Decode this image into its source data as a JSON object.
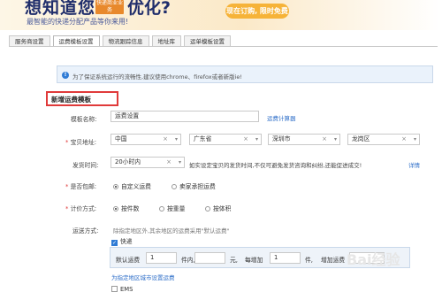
{
  "banner": {
    "headline_1": "想知道您",
    "tag": "快递商业业务",
    "headline_2": "优化?",
    "subtitle": "最智能的快递分配产品等你来用!",
    "cta": "现在订购, 限时免费"
  },
  "tabs": [
    "服务商设置",
    "运费模板设置",
    "物流跟踪信息",
    "地址库",
    "运单模板设置"
  ],
  "info": {
    "icon": "!",
    "text": "为了保证系统运行的流畅性,建议使用chrome、firefox或者新版ie!"
  },
  "section_title": "新增运费模板",
  "form": {
    "template_name_label": "模板名称:",
    "template_name_value": "运费设置",
    "calculator_link": "运费计算器",
    "origin_label": "宝贝地址:",
    "country": "中国",
    "province": "广东省",
    "city": "深圳市",
    "district": "龙岗区",
    "ship_time_label": "发货时间:",
    "ship_time_value": "20小时内",
    "ship_time_hint": "如实设定宝贝的发货时间,不仅可避免发货咨询和纠纷,还能促进成交!",
    "ship_time_link": "详情",
    "free_ship_label": "是否包邮:",
    "free_ship_options": [
      "自定义运费",
      "卖家承担运费"
    ],
    "pricing_label": "计价方式:",
    "pricing_options": [
      "按件数",
      "按重量",
      "按体积"
    ],
    "method_label": "运送方式:",
    "method_hint": "除指定地区外,其余地区的运费采用\"默认运费\"",
    "express_label": "快递",
    "fee": {
      "default_label": "默认运费",
      "first_value": "1",
      "unit_1": "件内,",
      "price_value": "",
      "unit_2": "元,",
      "each_add_label": "每增加",
      "add_value": "1",
      "unit_3": "件,",
      "add_fee_label": "增加运费"
    },
    "specify_link": "为指定地区城市设置运费",
    "ems_label": "EMS"
  },
  "watermark": "Bai经验"
}
